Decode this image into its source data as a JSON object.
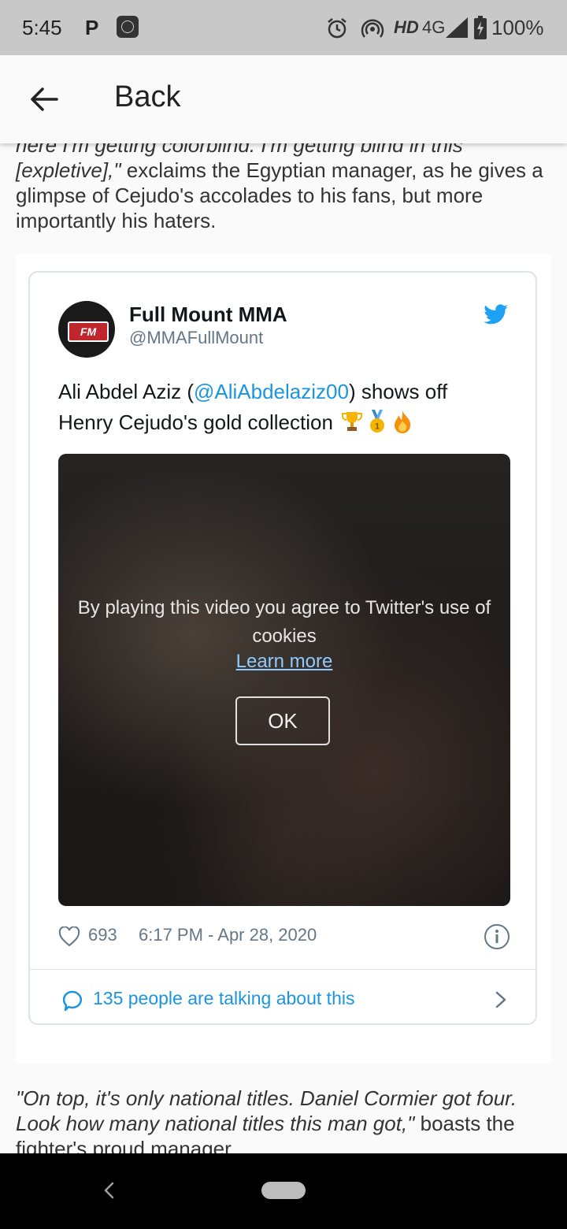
{
  "status_bar": {
    "time": "5:45",
    "p_icon": "P",
    "network_hd": "HD",
    "network_type": "4G",
    "battery": "100%",
    "icons": [
      "mi-icon",
      "alarm-icon",
      "hotspot-icon",
      "signal-icon",
      "battery-icon"
    ]
  },
  "app_bar": {
    "back_label": "Back"
  },
  "article": {
    "top_para_italic_1": "here I'm getting colorblind. I'm getting blind in this",
    "top_para_italic_2": "[expletive],\"",
    "top_para_rest": " exclaims the Egyptian manager, as he gives a glimpse of Cejudo's accolades to his fans, but more importantly his haters.",
    "bottom_para_italic": "\"On top, it's only national titles. Daniel Cormier got four. Look how many national titles this man got,\"",
    "bottom_para_rest": " boasts the fighter's proud manager."
  },
  "tweet": {
    "name": "Full Mount MMA",
    "handle": "@MMAFullMount",
    "avatar_text": "FM",
    "text_before": "Ali Abdel Aziz (",
    "mention": "@AliAbdelaziz00",
    "text_after": ") shows off Henry Cejudo's gold collection",
    "emojis": [
      "trophy-emoji",
      "medal-emoji",
      "fire-emoji"
    ],
    "video": {
      "cookie_message": "By playing this video you agree to Twitter's use of cookies",
      "learn_more": "Learn more",
      "ok_label": "OK"
    },
    "likes": "693",
    "timestamp": "6:17 PM - Apr 28, 2020",
    "talking": "135 people are talking about this"
  },
  "colors": {
    "twitter_blue": "#1b95e0",
    "status_bar_bg": "#c8c8c8",
    "nav_bar_bg": "#000000"
  }
}
